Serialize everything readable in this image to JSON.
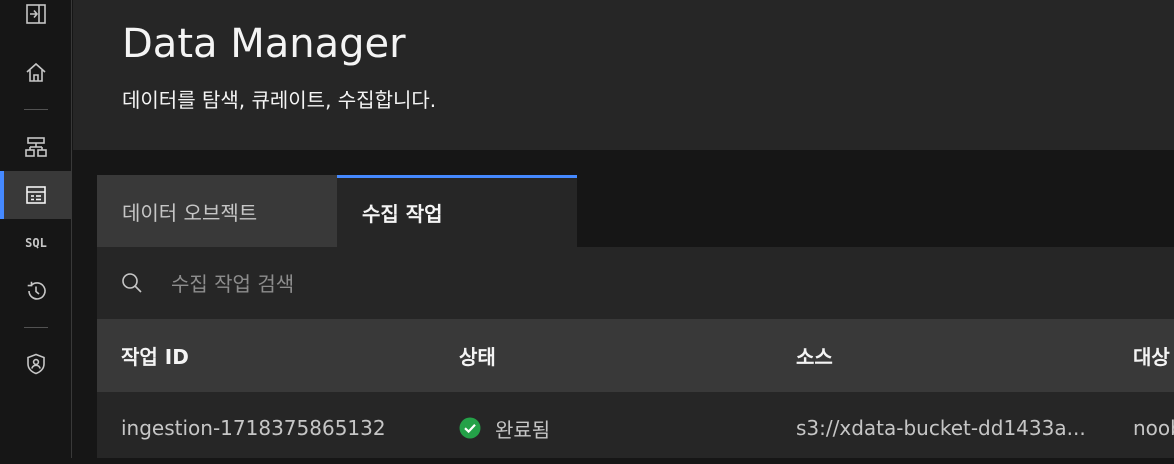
{
  "sidebar": {
    "items": [
      {
        "name": "collapse",
        "icon": "panel-expand-icon"
      },
      {
        "name": "home",
        "icon": "home-icon"
      },
      {
        "name": "infrastructure",
        "icon": "hierarchy-icon"
      },
      {
        "name": "data-manager",
        "icon": "data-table-icon",
        "active": true
      },
      {
        "name": "sql",
        "label": "SQL"
      },
      {
        "name": "history",
        "icon": "history-icon"
      },
      {
        "name": "access-control",
        "icon": "user-shield-icon"
      }
    ]
  },
  "header": {
    "title": "Data Manager",
    "subtitle": "데이터를 탐색, 큐레이트, 수집합니다."
  },
  "tabs": [
    {
      "label": "데이터 오브젝트",
      "selected": false
    },
    {
      "label": "수집 작업",
      "selected": true
    }
  ],
  "search": {
    "placeholder": "수집 작업 검색",
    "value": ""
  },
  "table": {
    "columns": [
      "작업 ID",
      "상태",
      "소스",
      "대상"
    ],
    "rows": [
      {
        "job_id": "ingestion-1718375865132",
        "status": "완료됨",
        "status_icon": "checkmark-filled-icon",
        "source": "s3://xdata-bucket-dd1433a...",
        "target": "noob"
      }
    ]
  },
  "colors": {
    "accent": "#4589ff",
    "success": "#24a148",
    "header_bg": "#262626",
    "page_bg": "#161616"
  }
}
